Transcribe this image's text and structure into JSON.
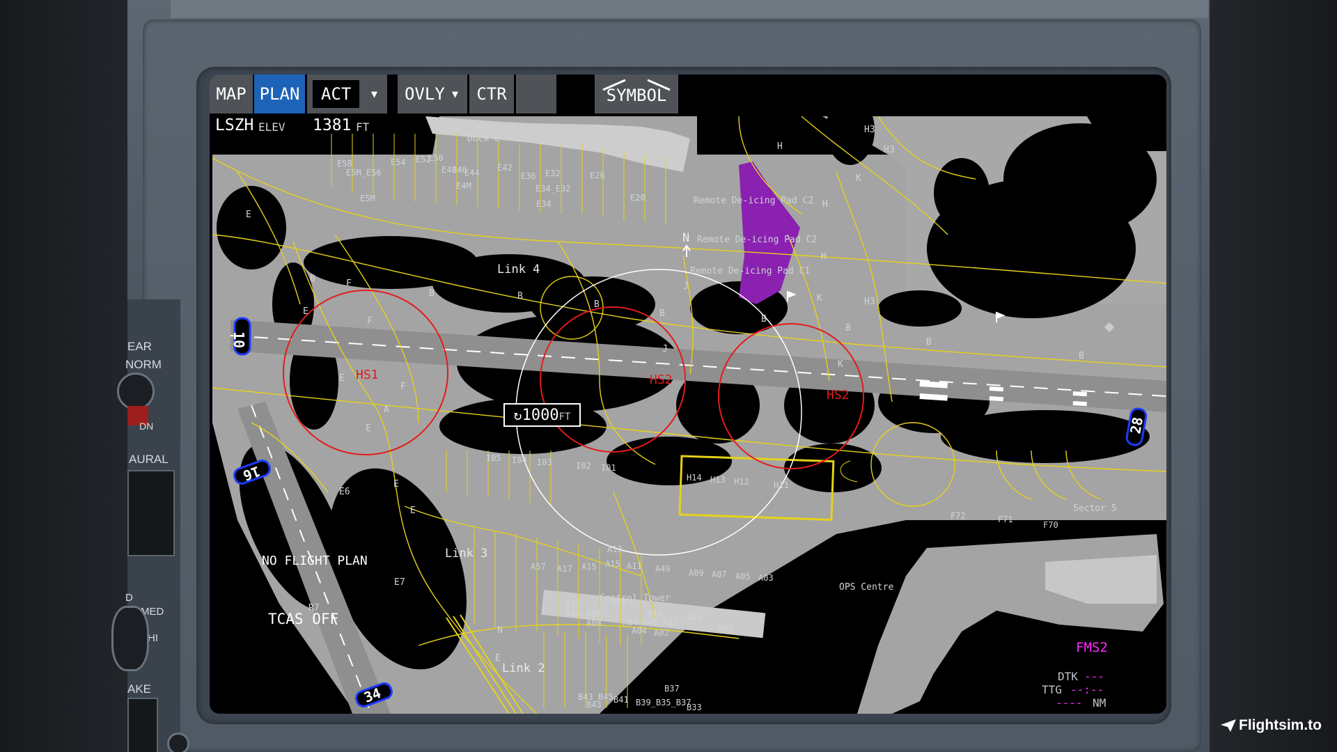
{
  "toolbar": {
    "map_label": "MAP",
    "plan_label": "PLAN",
    "act_label": "ACT",
    "ovly_label": "OVLY",
    "ctr_label": "CTR",
    "symbol_label": "SYMBOL",
    "caret": "▼"
  },
  "header": {
    "airport": "LSZH",
    "elev_label": "ELEV",
    "elevation": "1381",
    "elev_unit": "FT"
  },
  "status": {
    "flight_plan": "NO FLIGHT PLAN",
    "tcas": "TCAS OFF",
    "fms": "FMS2",
    "dtk_label": "DTK",
    "dtk_value": "---",
    "ttg_label": "TTG",
    "ttg_value": "--:--",
    "dist_value": "----",
    "dist_unit": "NM"
  },
  "range": {
    "value": "1000",
    "unit": "FT"
  },
  "map": {
    "north_label": "N",
    "runways": [
      "10",
      "28",
      "16",
      "34"
    ],
    "hotspots": [
      "HS1",
      "HS2",
      "HS2"
    ],
    "areas": [
      "Dock E",
      "Remote De-icing Pad C2",
      "Remote De-icing Pad C2",
      "Remote De-icing Pad C1",
      "Link 4",
      "Link 3",
      "Link 2",
      "Sector 5",
      "OPS Centre",
      "Control Tower"
    ],
    "taxiways": [
      "E",
      "B",
      "F",
      "E",
      "F",
      "E",
      "A",
      "F",
      "E",
      "E6",
      "E",
      "E",
      "E7",
      "R7",
      "N",
      "E",
      "B",
      "B",
      "B",
      "J",
      "J",
      "B",
      "K",
      "B",
      "B",
      "B",
      "H",
      "H",
      "H",
      "H3",
      "H3",
      "H3",
      "K",
      "K",
      "B"
    ],
    "stands_north": [
      "E58",
      "E5M_E56",
      "E54",
      "E52",
      "E50",
      "E48",
      "E46",
      "E44",
      "E42",
      "E4M",
      "E5M",
      "E36",
      "E34_E32",
      "E34",
      "E32",
      "E26",
      "E20"
    ],
    "stands_south": [
      "I05",
      "I04",
      "I03",
      "I02",
      "I01",
      "H14",
      "H13",
      "H12",
      "H11",
      "F72",
      "F71",
      "F70"
    ],
    "stands_apron": [
      "A13",
      "A57",
      "A17",
      "A15",
      "A15",
      "A11",
      "A49",
      "A09",
      "A07",
      "A05",
      "A03",
      "A10",
      "A10_A08",
      "A08",
      "A48",
      "A46",
      "A04_A46_A02",
      "A04",
      "A02",
      "A44",
      "A42",
      "B43_B45",
      "B41",
      "B43",
      "B39_B35_B37",
      "B37",
      "B33"
    ]
  },
  "overhead": {
    "label_ear": "EAR",
    "label_norm": "NORM",
    "label_dn": "DN",
    "label_aural": "AURAL",
    "label_med": "MED",
    "label_hi": "HI",
    "label_ake": "AKE",
    "label_d": "D"
  },
  "watermark": "Flightsim.to",
  "colors": {
    "taxiway_line": "#e6d21a",
    "hotspot": "#e31b1b",
    "deicing_pad": "#8a21b0",
    "active_button": "#1d63b8",
    "fms": "#ff29ff"
  }
}
